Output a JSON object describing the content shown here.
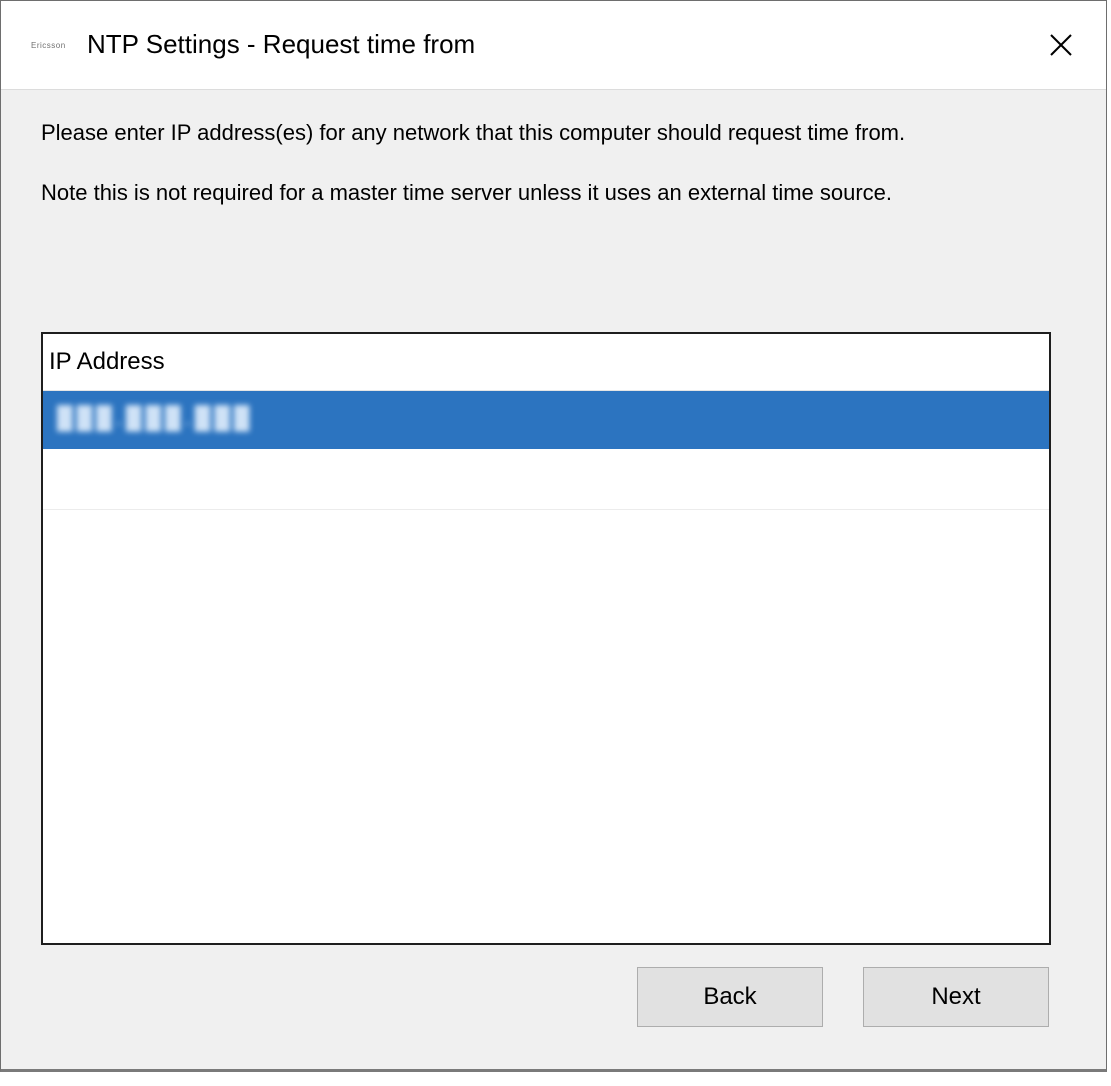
{
  "window": {
    "logo_text": "Ericsson",
    "title": "NTP Settings - Request time from"
  },
  "instructions": {
    "line1": "Please enter IP address(es) for any network that this computer should request time from.",
    "line2": "Note this is not required for a master time server unless it uses an external time source."
  },
  "ip_list": {
    "column_header": "IP Address",
    "rows": [
      {
        "value": "███.███.███",
        "selected": true
      }
    ]
  },
  "buttons": {
    "back_label": "Back",
    "next_label": "Next"
  },
  "colors": {
    "selection": "#2c74c0",
    "dialog_background": "#f0f0f0",
    "titlebar_background": "#ffffff"
  },
  "icons": {
    "close": "close-icon"
  }
}
